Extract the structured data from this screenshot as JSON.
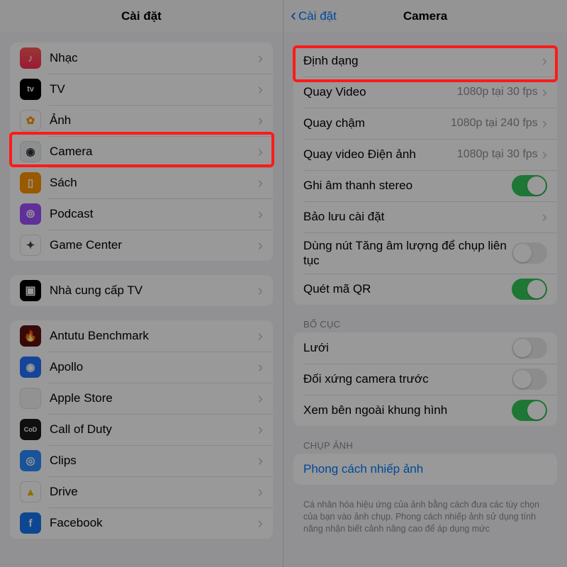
{
  "left": {
    "title": "Cài đặt",
    "group1": [
      {
        "icon": "music",
        "label": "Nhạc"
      },
      {
        "icon": "tv",
        "label": "TV"
      },
      {
        "icon": "photos",
        "label": "Ảnh"
      },
      {
        "icon": "camera",
        "label": "Camera"
      },
      {
        "icon": "books",
        "label": "Sách"
      },
      {
        "icon": "podcast",
        "label": "Podcast"
      },
      {
        "icon": "game",
        "label": "Game Center"
      }
    ],
    "group2": [
      {
        "icon": "tvprov",
        "label": "Nhà cung cấp TV"
      }
    ],
    "group3": [
      {
        "icon": "antutu",
        "label": "Antutu Benchmark"
      },
      {
        "icon": "apollo",
        "label": "Apollo"
      },
      {
        "icon": "appst",
        "label": "Apple Store"
      },
      {
        "icon": "cod",
        "label": "Call of Duty"
      },
      {
        "icon": "clips",
        "label": "Clips"
      },
      {
        "icon": "drive",
        "label": "Drive"
      },
      {
        "icon": "fb",
        "label": "Facebook"
      }
    ]
  },
  "right": {
    "back": "Cài đặt",
    "title": "Camera",
    "formats_label": "Định dạng",
    "rows": {
      "record_video": {
        "label": "Quay Video",
        "value": "1080p tại 30 fps"
      },
      "slo_mo": {
        "label": "Quay chậm",
        "value": "1080p tại 240 fps"
      },
      "cinematic": {
        "label": "Quay video Điện ảnh",
        "value": "1080p tại 30 fps"
      },
      "stereo": {
        "label": "Ghi âm thanh stereo",
        "on": true
      },
      "preserve": {
        "label": "Bảo lưu cài đặt"
      },
      "burst": {
        "label": "Dùng nút Tăng âm lượng để chụp liên tục",
        "on": false
      },
      "qr": {
        "label": "Quét mã QR",
        "on": true
      }
    },
    "composition_header": "BỐ CỤC",
    "composition": {
      "grid": {
        "label": "Lưới",
        "on": false
      },
      "mirror": {
        "label": "Đối xứng camera trước",
        "on": false
      },
      "outside": {
        "label": "Xem bên ngoài khung hình",
        "on": true
      }
    },
    "capture_header": "CHỤP ẢNH",
    "styles_label": "Phong cách nhiếp ảnh",
    "styles_note": "Cá nhân hóa hiệu ứng của ảnh bằng cách đưa các tùy chọn của bạn vào ảnh chụp. Phong cách nhiếp ảnh sử dụng tính năng nhận biết cảnh nâng cao để áp dụng mức"
  }
}
